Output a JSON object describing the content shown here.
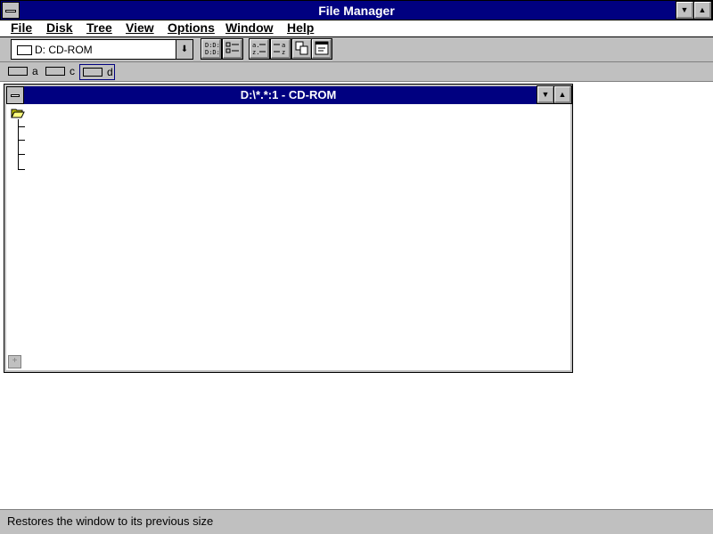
{
  "window": {
    "title": "File Manager"
  },
  "menu": [
    "File",
    "Disk",
    "Tree",
    "View",
    "Options",
    "Window",
    "Help"
  ],
  "toolbar": {
    "drive_select": "D: CD-ROM"
  },
  "drives": [
    {
      "letter": "a"
    },
    {
      "letter": "c"
    },
    {
      "letter": "d",
      "selected": true
    }
  ],
  "child_window": {
    "title": "D:\\*.*:1 - CD-ROM"
  },
  "status": {
    "text": "Restores the window to its previous size"
  },
  "colors": {
    "title_bar": "#000080",
    "chrome": "#c0c0c0",
    "background": "#ffffff"
  }
}
